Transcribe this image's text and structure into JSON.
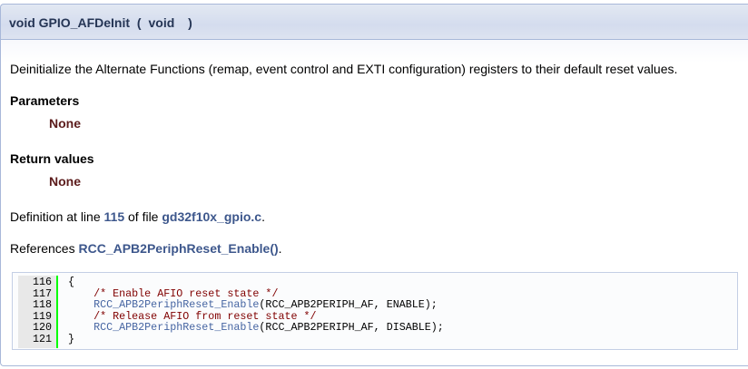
{
  "header": {
    "keyword": "void",
    "function_name": "GPIO_AFDeInit",
    "open_paren": "(",
    "param": "void",
    "close_paren": ")"
  },
  "brief": "Deinitialize the Alternate Functions (remap, event control and EXTI configuration) registers to their default reset values.",
  "parameters": {
    "title": "Parameters",
    "value": "None"
  },
  "return_values": {
    "title": "Return values",
    "value": "None"
  },
  "definition": {
    "prefix": "Definition at line ",
    "line": "115",
    "middle": " of file ",
    "file": "gd32f10x_gpio.c",
    "suffix": "."
  },
  "references": {
    "prefix": "References ",
    "link": "RCC_APB2PeriphReset_Enable()",
    "suffix": "."
  },
  "code": [
    {
      "n": "116",
      "text": "{"
    },
    {
      "n": "117",
      "indent": "    ",
      "comment": "/* Enable AFIO reset state */"
    },
    {
      "n": "118",
      "indent": "    ",
      "link": "RCC_APB2PeriphReset_Enable",
      "rest": "(RCC_APB2PERIPH_AF, ENABLE);"
    },
    {
      "n": "119",
      "indent": "    ",
      "comment": "/* Release AFIO from reset state */"
    },
    {
      "n": "120",
      "indent": "    ",
      "link": "RCC_APB2PeriphReset_Enable",
      "rest": "(RCC_APB2PERIPH_AF, DISABLE);"
    },
    {
      "n": "121",
      "text": "}"
    }
  ],
  "colors": {
    "header_text": "#253555",
    "link": "#3d578c",
    "param_value": "#5c1c1c",
    "comment": "#800000",
    "gutter_border": "#00ff00"
  }
}
